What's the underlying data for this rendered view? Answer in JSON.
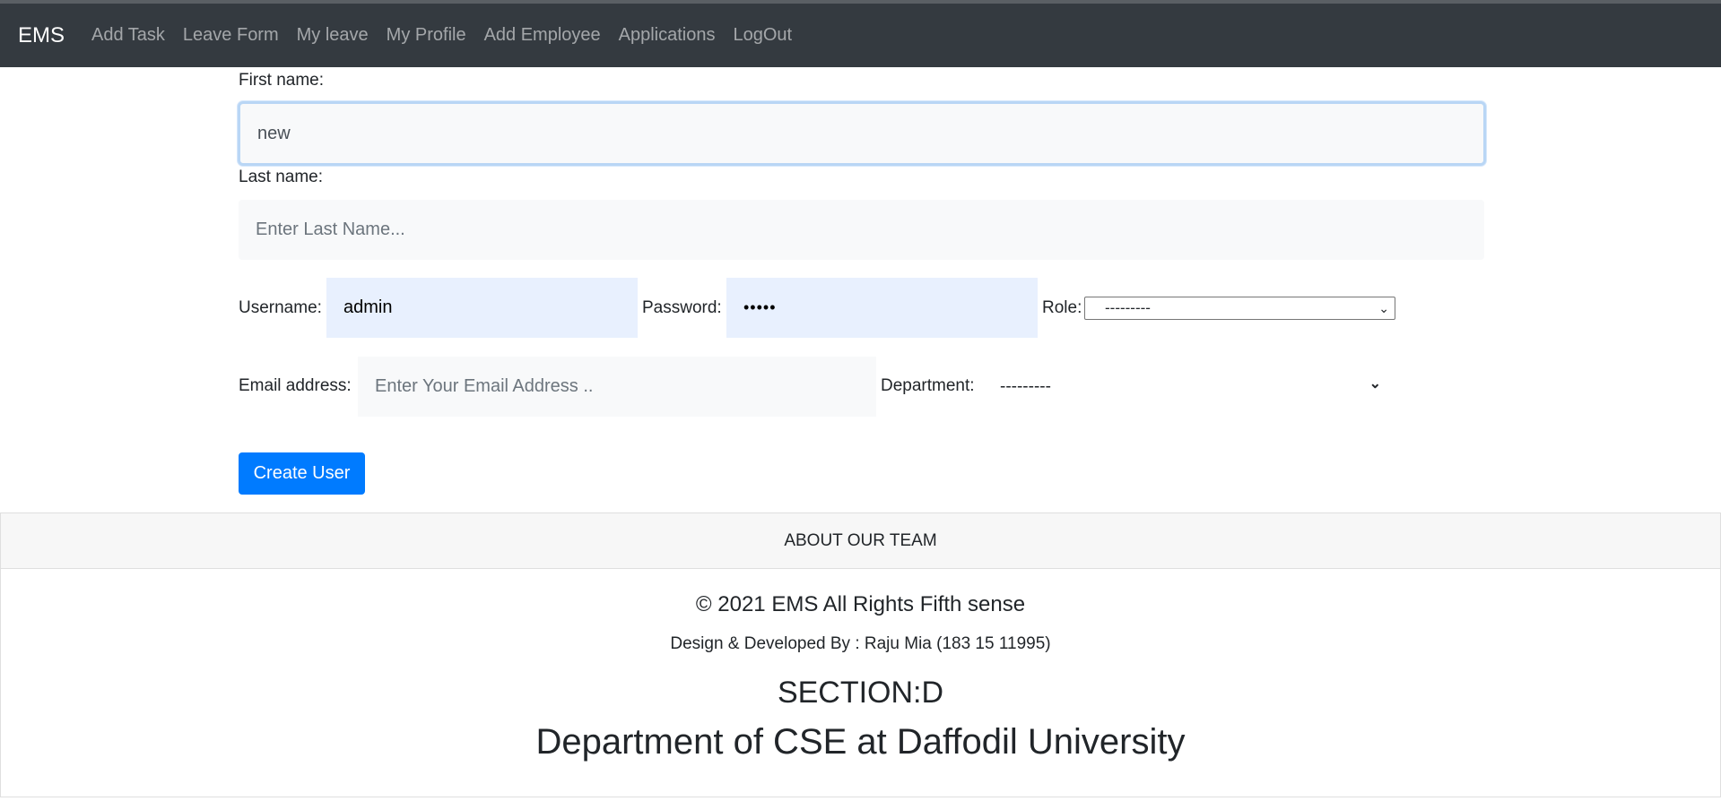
{
  "nav": {
    "brand": "EMS",
    "links": [
      "Add Task",
      "Leave Form",
      "My leave",
      "My Profile",
      "Add Employee",
      "Applications",
      "LogOut"
    ]
  },
  "form": {
    "first_name": {
      "label": "First name:",
      "value": "new"
    },
    "last_name": {
      "label": "Last name:",
      "placeholder": "Enter Last Name..."
    },
    "username": {
      "label": "Username:",
      "value": "admin"
    },
    "password": {
      "label": "Password:",
      "value": "•••••"
    },
    "role": {
      "label": "Role:",
      "selected": "---------"
    },
    "email": {
      "label": "Email address:",
      "placeholder": "Enter Your Email Address .."
    },
    "department": {
      "label": "Department:",
      "selected": "---------"
    },
    "submit_label": "Create User"
  },
  "footer": {
    "header": "ABOUT OUR TEAM",
    "copyright": "© 2021 EMS All Rights Fifth sense",
    "designer": "Design & Developed By : Raju Mia (183 15 11995)",
    "section": "SECTION:D",
    "department": "Department of CSE at Daffodil University"
  },
  "colors": {
    "navbar_bg": "#343a40",
    "primary_button": "#007bff",
    "autofill_bg": "#e8f0fe",
    "input_bg": "#f8f9fa"
  }
}
